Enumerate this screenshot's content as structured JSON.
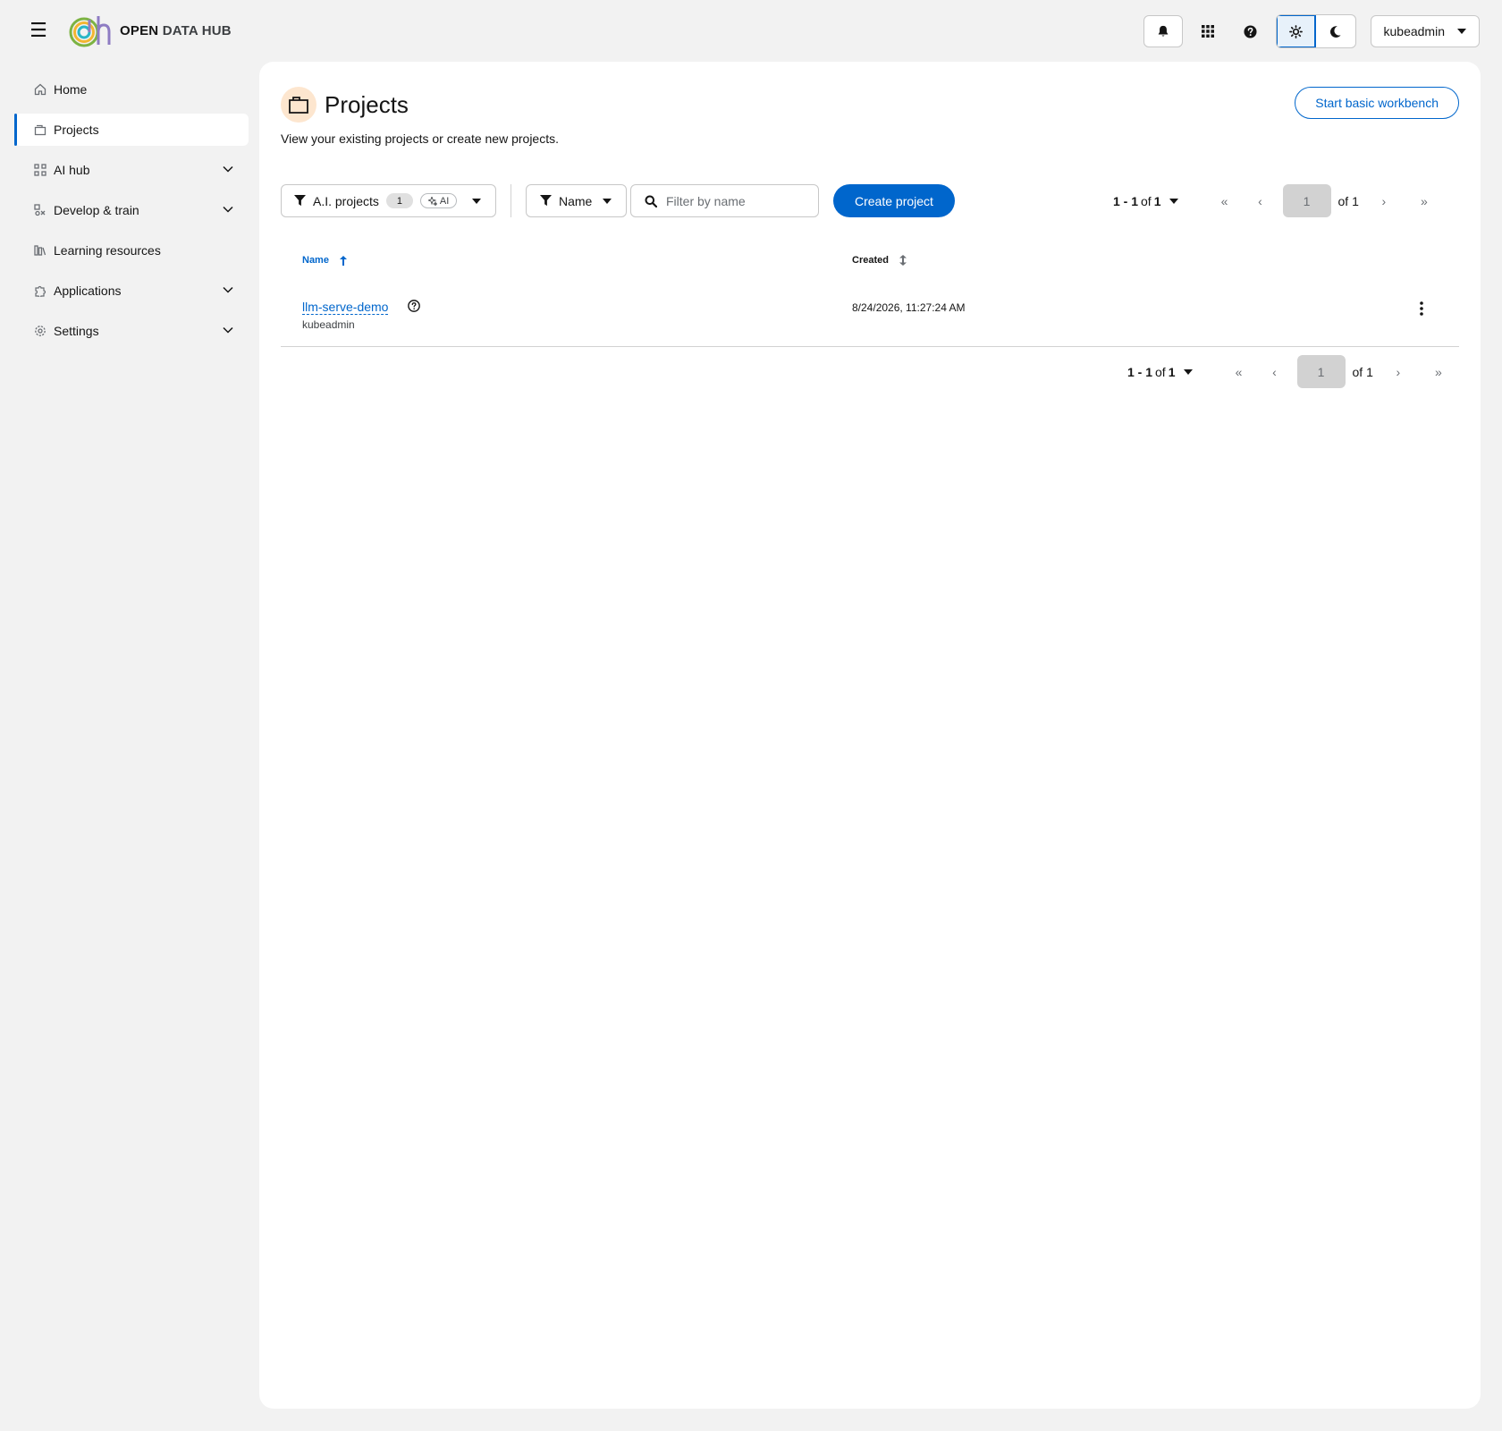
{
  "app": {
    "brand_bold": "OPEN",
    "brand_rest": "DATA HUB",
    "user": "kubeadmin"
  },
  "sidebar": {
    "items": [
      {
        "label": "Home",
        "icon": "home-icon"
      },
      {
        "label": "Projects",
        "icon": "folder-icon",
        "active": true
      },
      {
        "label": "AI hub",
        "icon": "ai-hub-icon",
        "expandable": true
      },
      {
        "label": "Develop & train",
        "icon": "develop-icon",
        "expandable": true
      },
      {
        "label": "Learning resources",
        "icon": "learning-icon"
      },
      {
        "label": "Applications",
        "icon": "puzzle-icon",
        "expandable": true
      },
      {
        "label": "Settings",
        "icon": "gear-icon",
        "expandable": true
      }
    ]
  },
  "page": {
    "title": "Projects",
    "description": "View your existing projects or create new projects.",
    "start_workbench": "Start basic workbench"
  },
  "toolbar": {
    "project_filter": "A.I. projects",
    "project_filter_count": "1",
    "ai_label": "AI",
    "attribute_filter": "Name",
    "search_placeholder": "Filter by name",
    "create_project": "Create project"
  },
  "pagination": {
    "range_bold": "1 - 1",
    "range_of": "of",
    "total": "1",
    "page": "1",
    "of_pages": "of 1"
  },
  "table": {
    "columns": [
      "Name",
      "Created"
    ],
    "rows": [
      {
        "name": "llm-serve-demo",
        "owner": "kubeadmin",
        "created": "8/24/2026, 11:27:24 AM"
      }
    ]
  },
  "colors": {
    "primary": "#0066cc",
    "project_icon_bg": "#fde6cf"
  }
}
